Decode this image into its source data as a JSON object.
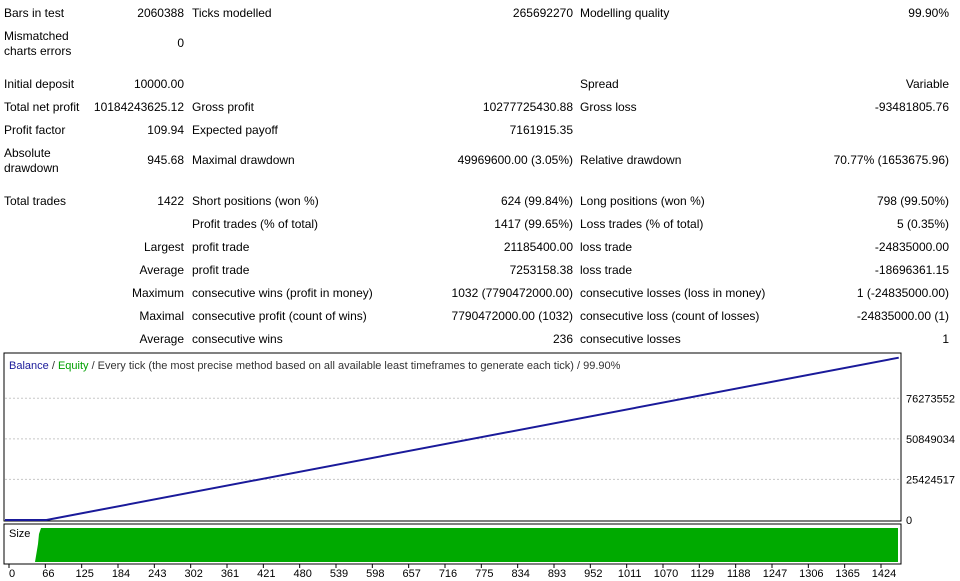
{
  "report": {
    "bars_in_test": {
      "label": "Bars in test",
      "value": "2060388"
    },
    "ticks_modelled": {
      "label": "Ticks modelled",
      "value": "265692270"
    },
    "modelling_quality": {
      "label": "Modelling quality",
      "value": "99.90%"
    },
    "mismatched": {
      "label_line1": "Mismatched",
      "label_line2": "charts errors",
      "value": "0"
    },
    "initial_deposit": {
      "label": "Initial deposit",
      "value": "10000.00"
    },
    "spread": {
      "label": "Spread",
      "value": "Variable"
    },
    "total_net_profit": {
      "label": "Total net profit",
      "value": "10184243625.12"
    },
    "gross_profit": {
      "label": "Gross profit",
      "value": "10277725430.88"
    },
    "gross_loss": {
      "label": "Gross loss",
      "value": "-93481805.76"
    },
    "profit_factor": {
      "label": "Profit factor",
      "value": "109.94"
    },
    "expected_payoff": {
      "label": "Expected payoff",
      "value": "7161915.35"
    },
    "absolute_drawdown": {
      "label_line1": "Absolute",
      "label_line2": "drawdown",
      "value": "945.68"
    },
    "maximal_drawdown": {
      "label": "Maximal drawdown",
      "value": "49969600.00 (3.05%)"
    },
    "relative_drawdown": {
      "label": "Relative drawdown",
      "value": "70.77% (1653675.96)"
    },
    "total_trades": {
      "label": "Total trades",
      "value": "1422"
    },
    "short_positions": {
      "label": "Short positions (won %)",
      "value": "624 (99.84%)"
    },
    "long_positions": {
      "label": "Long positions (won %)",
      "value": "798 (99.50%)"
    },
    "profit_trades": {
      "label": "Profit trades (% of total)",
      "value": "1417 (99.65%)"
    },
    "loss_trades": {
      "label": "Loss trades (% of total)",
      "value": "5 (0.35%)"
    },
    "largest": {
      "label": "Largest",
      "profit_label": "profit trade",
      "profit_value": "21185400.00",
      "loss_label": "loss trade",
      "loss_value": "-24835000.00"
    },
    "average": {
      "label": "Average",
      "profit_label": "profit trade",
      "profit_value": "7253158.38",
      "loss_label": "loss trade",
      "loss_value": "-18696361.15"
    },
    "maximum": {
      "label": "Maximum",
      "wins_label": "consecutive wins (profit in money)",
      "wins_value": "1032 (7790472000.00)",
      "losses_label": "consecutive losses (loss in money)",
      "losses_value": "1 (-24835000.00)"
    },
    "maximal": {
      "label": "Maximal",
      "profit_label": "consecutive profit (count of wins)",
      "profit_value": "7790472000.00 (1032)",
      "loss_label": "consecutive loss (count of losses)",
      "loss_value": "-24835000.00 (1)"
    },
    "average_consec": {
      "label": "Average",
      "wins_label": "consecutive wins",
      "wins_value": "236",
      "losses_label": "consecutive losses",
      "losses_value": "1"
    }
  },
  "chart_data": {
    "type": "line",
    "legend": {
      "balance": "Balance",
      "sep1": " / ",
      "equity": "Equity",
      "rest": " / Every tick (the most precise method based on all available least timeframes to generate each tick) / 99.90%"
    },
    "series": [
      {
        "name": "Balance",
        "color": "#1a1a9a"
      },
      {
        "name": "Equity",
        "color": "#00a000"
      }
    ],
    "x": [
      0,
      66,
      1422
    ],
    "y": [
      10000,
      10000,
      101700000
    ],
    "y_ticks": [
      "0",
      "25424517",
      "50849034",
      "76273552"
    ],
    "y_tick_values": [
      0,
      25424517,
      50849034,
      76273552
    ],
    "ylim": [
      0,
      104000000
    ],
    "x_ticks": [
      "0",
      "66",
      "125",
      "184",
      "243",
      "302",
      "361",
      "421",
      "480",
      "539",
      "598",
      "657",
      "716",
      "775",
      "834",
      "893",
      "952",
      "1011",
      "1070",
      "1129",
      "1188",
      "1247",
      "1306",
      "1365",
      "1424"
    ],
    "xlim": [
      0,
      1424
    ],
    "size_panel": {
      "label": "Size",
      "color": "#00aa00"
    }
  }
}
